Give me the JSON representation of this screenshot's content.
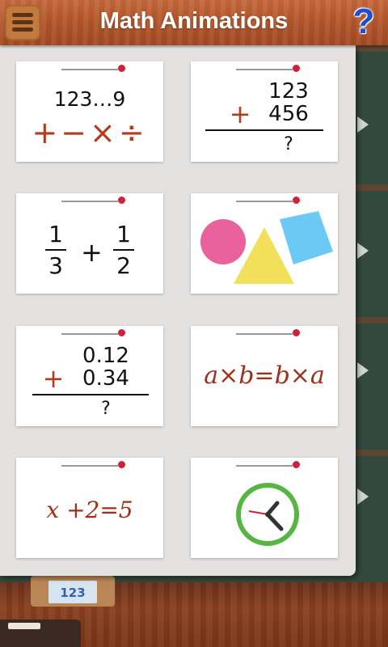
{
  "header": {
    "title": "Math Animations",
    "help_label": "?",
    "menu_icon": "hamburger-menu-icon"
  },
  "cards": [
    {
      "id": "arithmetic",
      "line1": "123…9",
      "ops": "+−×÷"
    },
    {
      "id": "column-addition",
      "line1": "123",
      "line2": "456",
      "op": "+",
      "result": "?"
    },
    {
      "id": "fractions",
      "n1": "1",
      "d1": "3",
      "op": "+",
      "n2": "1",
      "d2": "2"
    },
    {
      "id": "shapes",
      "shapes": [
        "circle",
        "triangle",
        "square"
      ]
    },
    {
      "id": "decimals",
      "line1": "0.12",
      "line2": "0.34",
      "op": "+",
      "result": "?"
    },
    {
      "id": "commutative",
      "text": "a×b=b×a"
    },
    {
      "id": "equation",
      "text": "x +2=5"
    },
    {
      "id": "clock",
      "icon": "clock-icon"
    }
  ],
  "bottom": {
    "card_text": "123"
  },
  "colors": {
    "header_wood": "#b4572c",
    "operator_red": "#b33c1f",
    "pin_red": "#d0213a",
    "circle_pink": "#e9629c",
    "triangle_yellow": "#f2e05a",
    "square_blue": "#6cc9f5",
    "clock_green": "#56b543"
  }
}
